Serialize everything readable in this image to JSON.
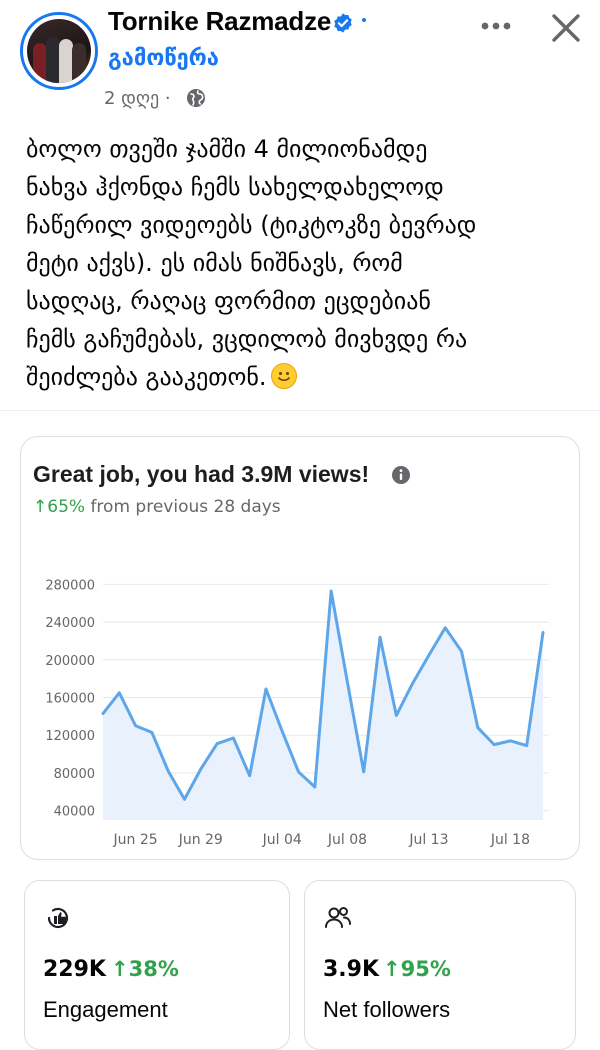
{
  "post": {
    "author": "Tornike Razmadze",
    "follow_label": "გამოწერა",
    "time": "2 დღე ·",
    "text_lines": [
      "ბოლო თვეში ჯამში 4 მილიონამდე",
      "ნახვა ჰქონდა ჩემს სახელდახელოდ",
      "ჩაწერილ ვიდეოებს (ტიკტოკზე ბევრად",
      "მეტი აქვს). ეს იმას ნიშნავს, რომ",
      "სადღაც, რაღაც ფორმით ეცდებიან",
      "ჩემს გაჩუმებას, ვცდილობ მივხვდე რა",
      "შეიძლება გააკეთონ."
    ],
    "icons": {
      "verified": "verified-badge-icon",
      "globe": "globe-icon",
      "more": "more-icon",
      "close": "close-icon",
      "emoji": "smiling-face-emoji"
    }
  },
  "card": {
    "title": "Great job, you had 3.9M views!",
    "change_arrow": "↑",
    "change_value": "65%",
    "change_text": " from previous 28 days"
  },
  "chart_data": {
    "type": "area",
    "title": "",
    "xlabel": "",
    "ylabel": "",
    "x_tick_labels": [
      "Jun 25",
      "Jun 29",
      "Jul 04",
      "Jul 08",
      "Jul 13",
      "Jul 18"
    ],
    "y_ticks": [
      40000,
      80000,
      120000,
      160000,
      200000,
      240000,
      280000
    ],
    "ylim": [
      30000,
      290000
    ],
    "grid": true,
    "color": "#5ea6ea",
    "fill_color": "#e8f1fc",
    "series": [
      {
        "values": [
          143000,
          165000,
          130000,
          123000,
          82000,
          52000,
          84000,
          111000,
          117000,
          77000,
          169000,
          124000,
          81000,
          65000,
          273000,
          176000,
          81000,
          224000,
          141000,
          175000,
          205000,
          234000,
          209000,
          128000,
          110000,
          114000,
          109000,
          229000
        ]
      }
    ]
  },
  "stats": {
    "engagement": {
      "value": "229K",
      "arrow": "↑",
      "change": "38%",
      "label": "Engagement"
    },
    "followers": {
      "value": "3.9K",
      "arrow": "↑",
      "change": "95%",
      "label": "Net followers"
    }
  }
}
